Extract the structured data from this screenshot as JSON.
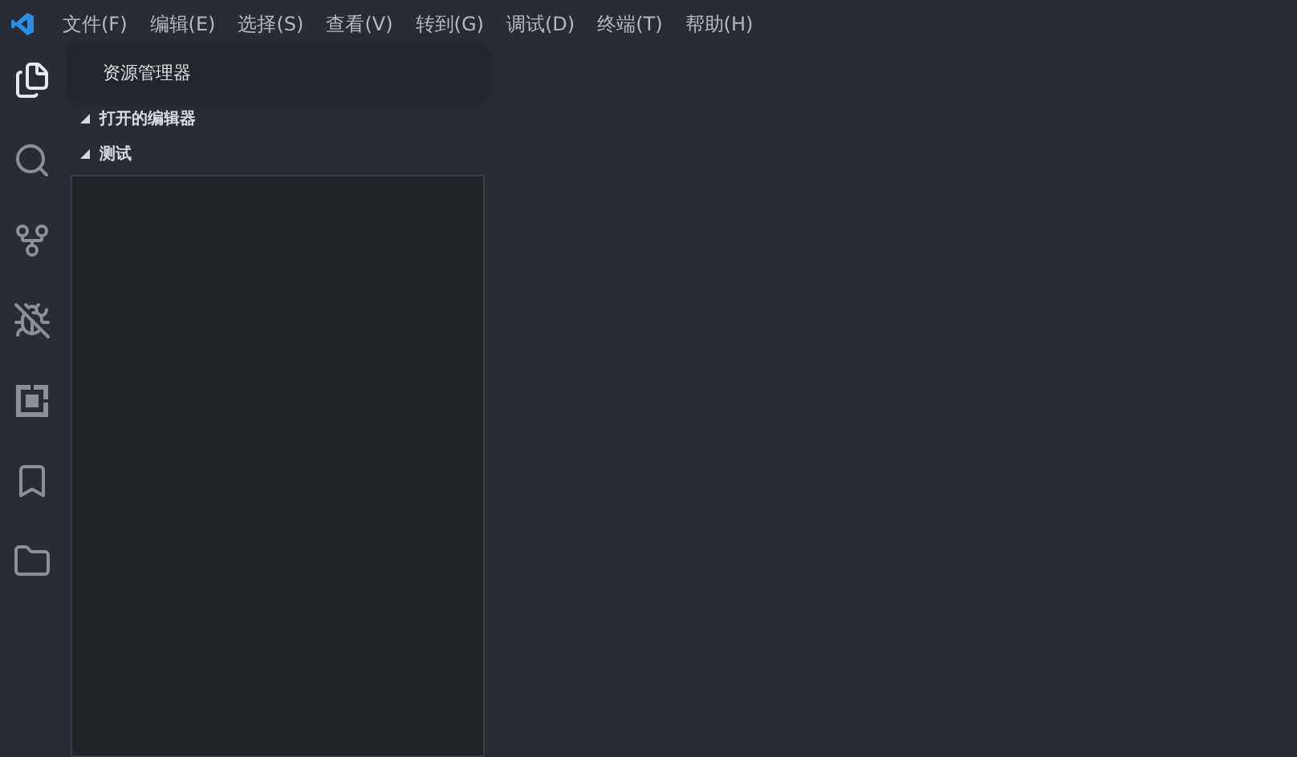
{
  "menu_bar": {
    "items": [
      "文件(F)",
      "编辑(E)",
      "选择(S)",
      "查看(V)",
      "转到(G)",
      "调试(D)",
      "终端(T)",
      "帮助(H)"
    ]
  },
  "activity_bar": {
    "items": [
      {
        "kind": "files",
        "selected": true
      },
      {
        "kind": "search",
        "selected": false
      },
      {
        "kind": "source-control",
        "selected": false
      },
      {
        "kind": "debug",
        "selected": false
      },
      {
        "kind": "extensions",
        "selected": false
      },
      {
        "kind": "bookmark",
        "selected": false
      },
      {
        "kind": "folder",
        "selected": false
      }
    ]
  },
  "sidebar": {
    "title": "资源管理器",
    "sections": [
      {
        "label": "打开的编辑器",
        "expanded": true
      },
      {
        "label": "测试",
        "expanded": true
      }
    ]
  }
}
